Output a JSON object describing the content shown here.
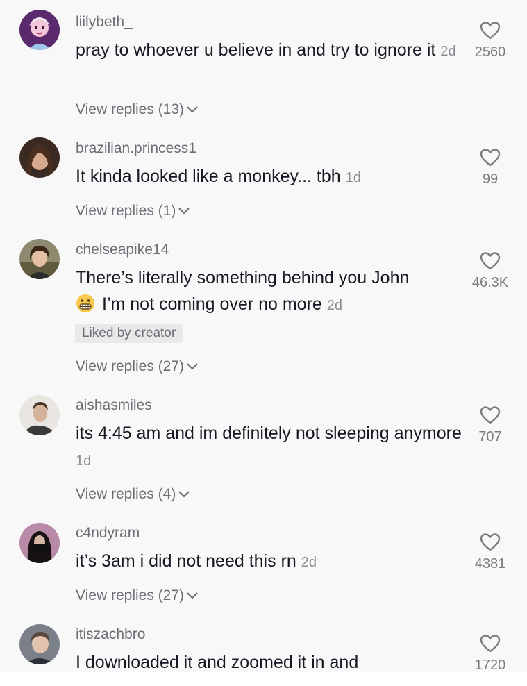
{
  "comments": [
    {
      "username": "liilybeth_",
      "text": "pray to whoever u believe in and try to ignore it",
      "time": "2d",
      "likes": "2560",
      "replies_label": "View replies (13)",
      "avatar_icon": "cartoon-avatar-icon"
    },
    {
      "username": "brazilian.princess1",
      "text": "It kinda looked like a monkey... tbh",
      "time": "1d",
      "likes": "99",
      "replies_label": "View replies (1)",
      "avatar_icon": "user-photo-avatar-icon"
    },
    {
      "username": "chelseapike14",
      "text_line1": "There’s literally something behind you John",
      "text_line2": "I’m not coming over no more",
      "time": "2d",
      "likes": "46.3K",
      "liked_by_creator": "Liked by creator",
      "replies_label": "View replies (27)",
      "emoji": "grimacing-face-emoji"
    },
    {
      "username": "aishasmiles",
      "text": "its 4:45 am and im definitely not sleeping anymore",
      "time": "1d",
      "likes": "707",
      "replies_label": "View replies (4)"
    },
    {
      "username": "c4ndyram",
      "text": "it’s 3am i did not need this rn",
      "time": "2d",
      "likes": "4381",
      "replies_label": "View replies (27)"
    },
    {
      "username": "itiszachbro",
      "text": "I downloaded it and zoomed it in and",
      "likes": "1720"
    }
  ],
  "icons": {
    "like": "heart-outline-icon",
    "expand": "chevron-down-icon"
  },
  "colors": {
    "background": "#f8f8f8",
    "primary_text": "#161823",
    "secondary_text": "#6d6d75"
  }
}
